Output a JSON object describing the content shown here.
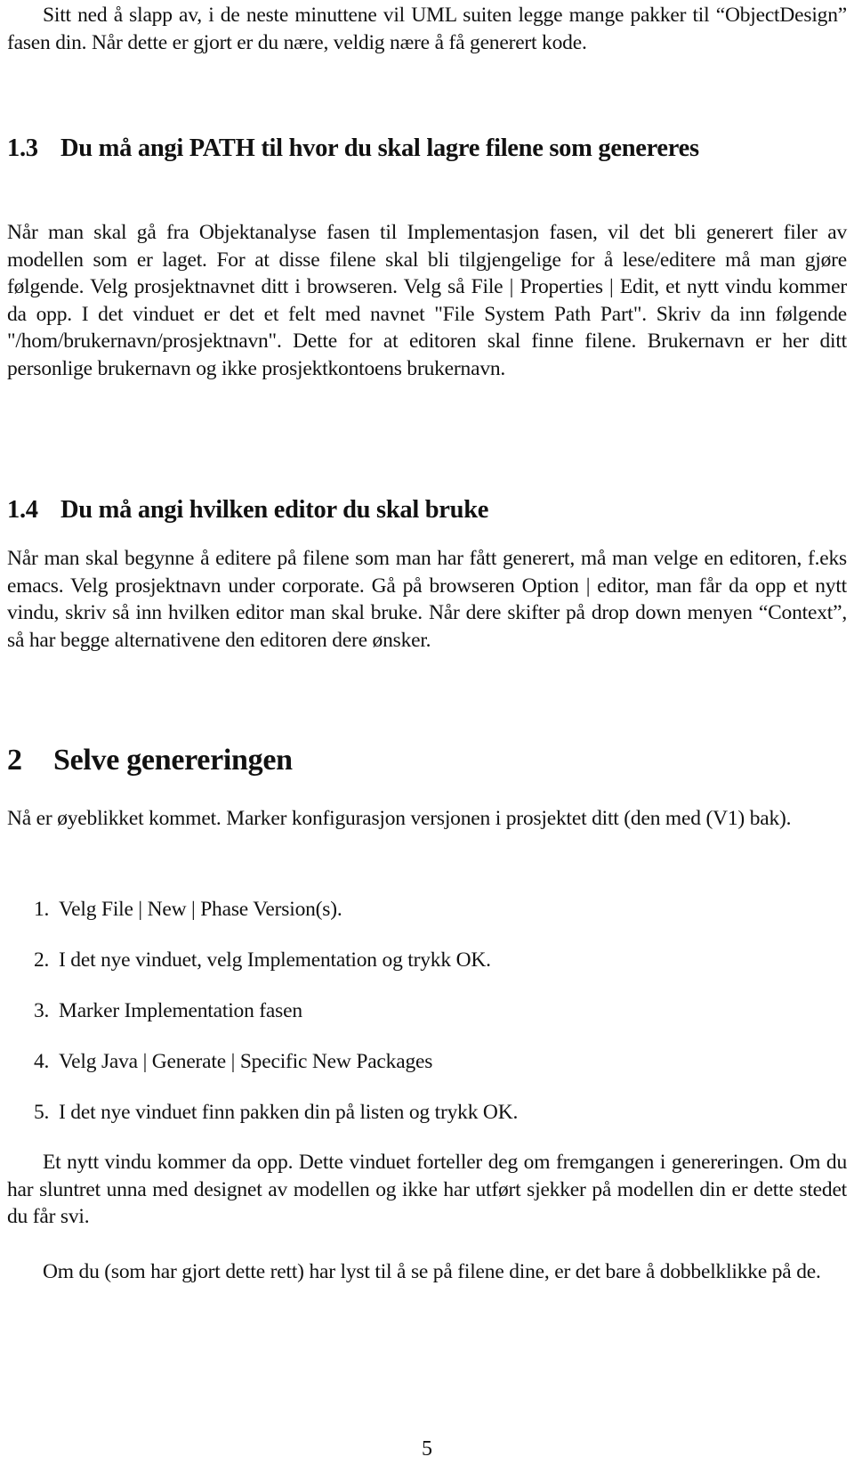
{
  "intro_paragraph": "Sitt ned å slapp av, i de neste minuttene vil UML suiten legge mange pakker til “ObjectDesign” fasen din. Når dette er gjort er du nære, veldig nære å få generert kode.",
  "section_1_3": {
    "number": "1.3",
    "title": "Du må angi PATH til hvor du skal lagre filene som genereres",
    "paragraph": "Når man skal gå fra Objektanalyse fasen til Implementasjon fasen, vil det bli generert filer av modellen som er laget. For at disse filene skal bli tilgjengelige for å lese/editere må man gjøre følgende. Velg prosjektnavnet ditt i browseren. Velg så File | Properties | Edit, et nytt vindu kommer da opp. I det vinduet er det et felt med navnet \"File System Path Part\". Skriv da inn følgende \"/hom/brukernavn/prosjektnavn\". Dette for at editoren skal finne filene. Brukernavn er her ditt personlige brukernavn og ikke prosjektkontoens brukernavn."
  },
  "section_1_4": {
    "number": "1.4",
    "title": "Du må angi hvilken editor du skal bruke",
    "paragraph": "Når man skal begynne å editere på filene som man har fått generert, må man velge en editoren, f.eks emacs. Velg prosjektnavn under corporate. Gå på browseren Option | editor, man får da opp et nytt vindu, skriv så inn hvilken editor man skal bruke. Når dere skifter på drop down menyen “Context”, så har begge alternativene den editoren dere ønsker."
  },
  "section_2": {
    "number": "2",
    "title": "Selve genereringen",
    "paragraph": "Nå er øyeblikket kommet. Marker konfigurasjon versjonen i prosjektet ditt (den med (V1) bak).",
    "steps": [
      {
        "num": "1.",
        "text": "Velg File | New | Phase Version(s)."
      },
      {
        "num": "2.",
        "text": "I det nye vinduet, velg Implementation og trykk OK."
      },
      {
        "num": "3.",
        "text": "Marker Implementation fasen"
      },
      {
        "num": "4.",
        "text": "Velg Java | Generate | Specific New Packages"
      },
      {
        "num": "5.",
        "text": "I det nye vinduet finn pakken din på listen og trykk OK."
      }
    ],
    "after_paragraph_1": "Et nytt vindu kommer da opp. Dette vinduet forteller deg om fremgangen i genereringen. Om du har sluntret unna med designet av modellen og ikke har utført sjekker på modellen din er dette stedet du får svi.",
    "after_paragraph_2": "Om du (som har gjort dette rett) har lyst til å se på filene dine, er det bare å dobbelklikke på de."
  },
  "page_number": "5"
}
